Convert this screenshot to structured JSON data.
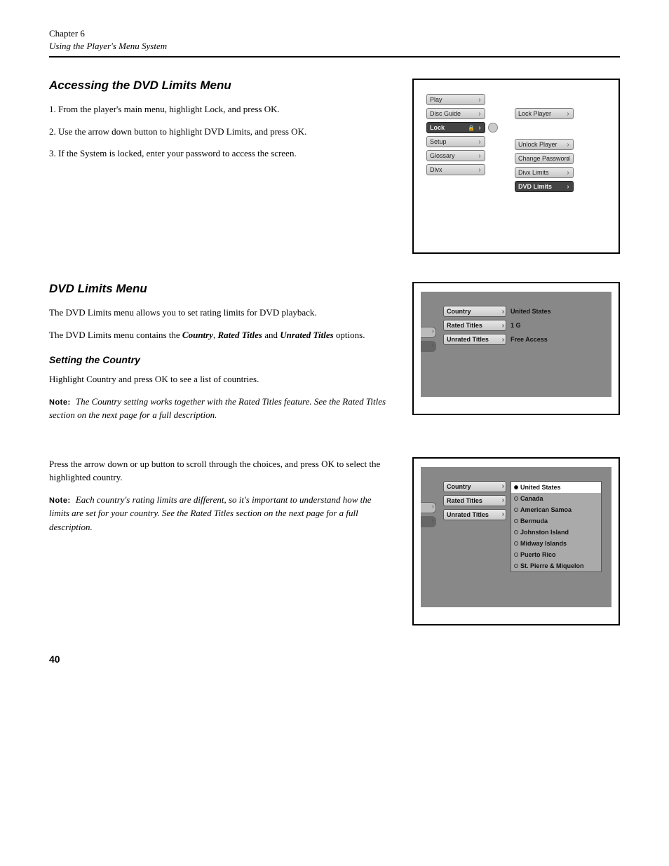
{
  "header": {
    "chapter_num": "Chapter 6",
    "chapter_title": "Using the Player's Menu System"
  },
  "section1": {
    "title": "Accessing the DVD Limits Menu",
    "step1": "1. From the player's main menu, highlight Lock, and press OK.",
    "step2": "2. Use the arrow down button to highlight DVD Limits, and press OK.",
    "step3": "3. If the System is locked, enter your password to access the screen.",
    "fig1": {
      "left_menu": [
        {
          "label": "Play",
          "selected": false,
          "bind": "section1.fig1.left_menu.0.label"
        },
        {
          "label": "Disc Guide",
          "selected": false,
          "bind": "section1.fig1.left_menu.1.label"
        },
        {
          "label": "Lock",
          "selected": true,
          "bind": "section1.fig1.left_menu.2.label",
          "icon": "lock"
        },
        {
          "label": "Setup",
          "selected": false,
          "bind": "section1.fig1.left_menu.3.label"
        },
        {
          "label": "Glossary",
          "selected": false,
          "bind": "section1.fig1.left_menu.4.label"
        },
        {
          "label": "Divx",
          "selected": false,
          "bind": "section1.fig1.left_menu.5.label"
        }
      ],
      "right_menu": [
        {
          "label": "Lock Player",
          "selected": false
        },
        {
          "label": "Unlock Player",
          "selected": false
        },
        {
          "label": "Change Password",
          "selected": false
        },
        {
          "label": "Divx Limits",
          "selected": false
        },
        {
          "label": "DVD Limits",
          "selected": true
        }
      ]
    }
  },
  "section2": {
    "title": "DVD Limits Menu",
    "p1": "The DVD Limits menu allows you to set rating limits for DVD playback.",
    "p2_pre": "The DVD Limits menu contains the ",
    "p2_b1": "Country",
    "p2_mid1": ", ",
    "p2_b2": "Rated Titles",
    "p2_mid2": " and ",
    "p2_b3": "Unrated Titles",
    "p2_post": " options.",
    "sub_heading": "Setting the Country",
    "p3": "Highlight Country and press OK to see a list of countries.",
    "note1_label": "Note:",
    "note1": " The Country setting works together with the Rated Titles feature. See the Rated Titles section on the next page for a full description.",
    "fig2": {
      "country_label": "Country",
      "rated_label": "Rated Titles",
      "unrated_label": "Unrated Titles",
      "country_value": "United States",
      "rated_value": "1 G",
      "unrated_value": "Free Access"
    }
  },
  "section3": {
    "p1": "Press the arrow down or up button to scroll through the choices, and press OK to select the highlighted country.",
    "note2_label": "Note:",
    "note2": " Each country's rating limits are different, so it's important to understand how the limits are set for your country. See the Rated Titles section on the next page for a full description.",
    "fig3": {
      "country_label": "Country",
      "rated_label": "Rated Titles",
      "unrated_label": "Unrated Titles",
      "countries": [
        {
          "name": "United States",
          "selected": true
        },
        {
          "name": "Canada",
          "selected": false
        },
        {
          "name": "American Samoa",
          "selected": false
        },
        {
          "name": "Bermuda",
          "selected": false
        },
        {
          "name": "Johnston Island",
          "selected": false
        },
        {
          "name": "Midway Islands",
          "selected": false
        },
        {
          "name": "Puerto Rico",
          "selected": false
        },
        {
          "name": "St. Pierre & Miquelon",
          "selected": false
        }
      ]
    }
  },
  "footer": {
    "page_num": "40"
  }
}
